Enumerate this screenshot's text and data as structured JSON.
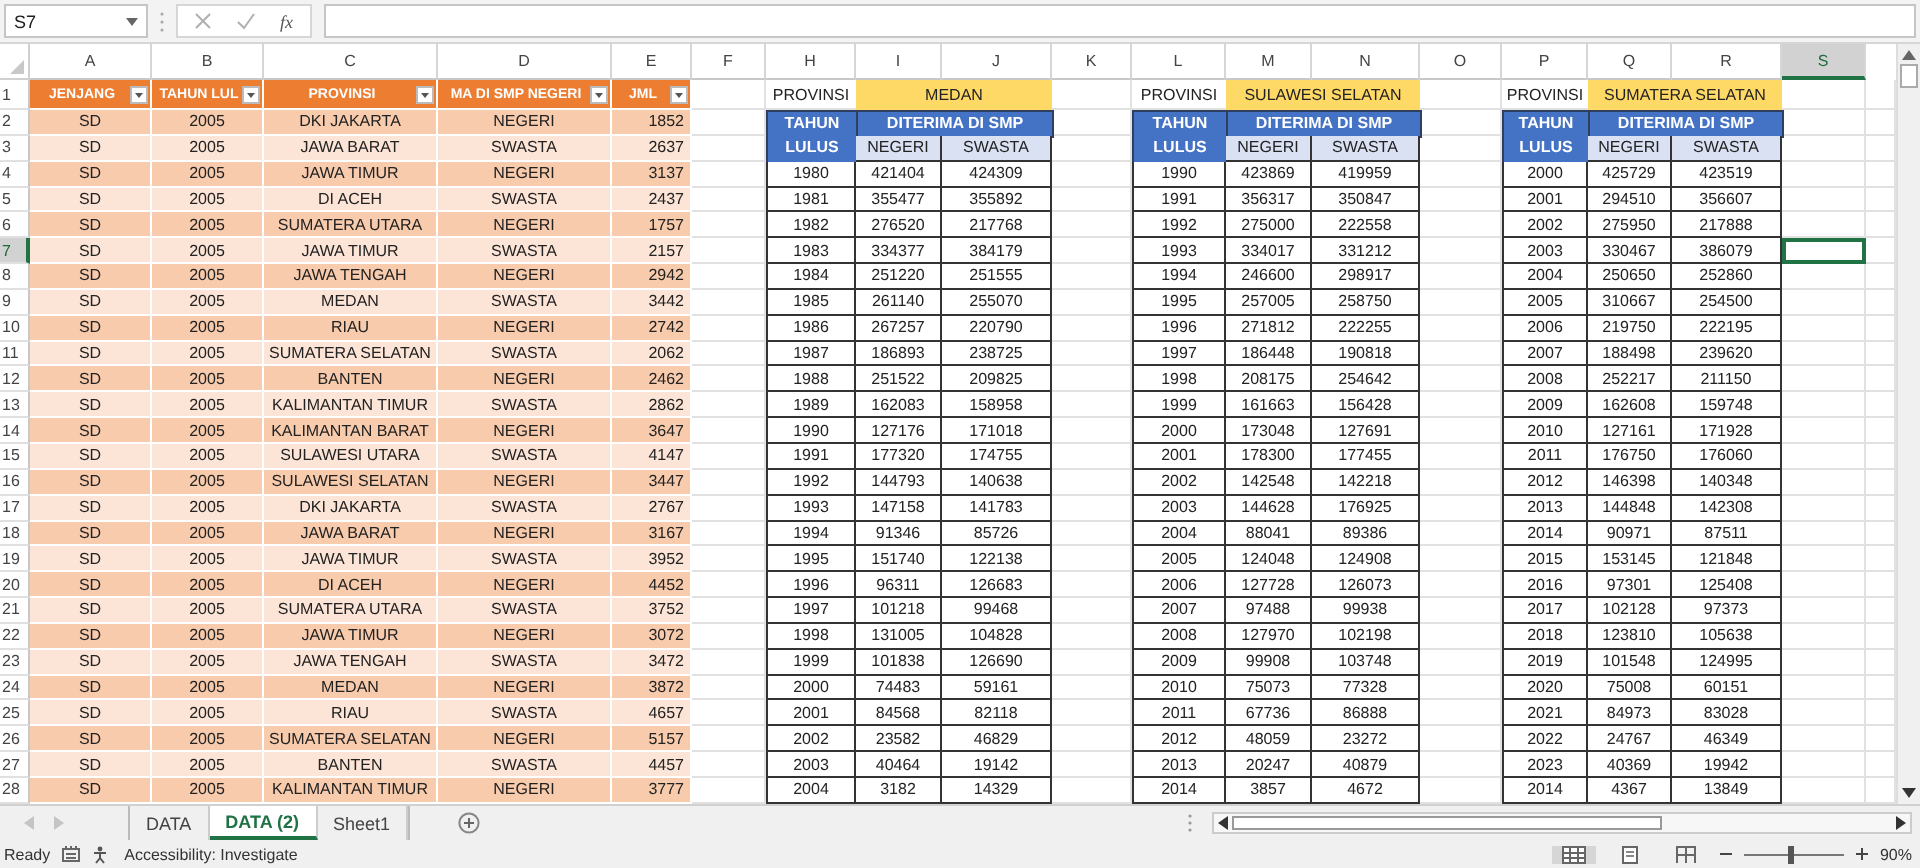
{
  "formula_bar": {
    "name_box": "S7",
    "function_button": "fx"
  },
  "columns": [
    {
      "label": "A",
      "selected": false
    },
    {
      "label": "B",
      "selected": false
    },
    {
      "label": "C",
      "selected": false
    },
    {
      "label": "D",
      "selected": false
    },
    {
      "label": "E",
      "selected": false
    },
    {
      "label": "F",
      "selected": false
    },
    {
      "label": "H",
      "selected": false
    },
    {
      "label": "I",
      "selected": false
    },
    {
      "label": "J",
      "selected": false
    },
    {
      "label": "K",
      "selected": false
    },
    {
      "label": "L",
      "selected": false
    },
    {
      "label": "M",
      "selected": false
    },
    {
      "label": "N",
      "selected": false
    },
    {
      "label": "O",
      "selected": false
    },
    {
      "label": "P",
      "selected": false
    },
    {
      "label": "Q",
      "selected": false
    },
    {
      "label": "R",
      "selected": false
    },
    {
      "label": "S",
      "selected": true
    }
  ],
  "row_numbers": [
    {
      "label": "1",
      "selected": false
    },
    {
      "label": "2",
      "selected": false
    },
    {
      "label": "3",
      "selected": false
    },
    {
      "label": "4",
      "selected": false
    },
    {
      "label": "5",
      "selected": false
    },
    {
      "label": "6",
      "selected": false
    },
    {
      "label": "7",
      "selected": true
    },
    {
      "label": "8",
      "selected": false
    },
    {
      "label": "9",
      "selected": false
    },
    {
      "label": "10",
      "selected": false
    },
    {
      "label": "11",
      "selected": false
    },
    {
      "label": "12",
      "selected": false
    },
    {
      "label": "13",
      "selected": false
    },
    {
      "label": "14",
      "selected": false
    },
    {
      "label": "15",
      "selected": false
    },
    {
      "label": "16",
      "selected": false
    },
    {
      "label": "17",
      "selected": false
    },
    {
      "label": "18",
      "selected": false
    },
    {
      "label": "19",
      "selected": false
    },
    {
      "label": "20",
      "selected": false
    },
    {
      "label": "21",
      "selected": false
    },
    {
      "label": "22",
      "selected": false
    },
    {
      "label": "23",
      "selected": false
    },
    {
      "label": "24",
      "selected": false
    },
    {
      "label": "25",
      "selected": false
    },
    {
      "label": "26",
      "selected": false
    },
    {
      "label": "27",
      "selected": false
    },
    {
      "label": "28",
      "selected": false
    }
  ],
  "data_table": {
    "headers": [
      "JENJANG",
      "TAHUN LUL",
      "PROVINSI",
      "MA DI SMP NEGERI",
      "JML"
    ],
    "rows": [
      [
        "SD",
        "2005",
        "DKI JAKARTA",
        "NEGERI",
        "1852"
      ],
      [
        "SD",
        "2005",
        "JAWA BARAT",
        "SWASTA",
        "2637"
      ],
      [
        "SD",
        "2005",
        "JAWA TIMUR",
        "NEGERI",
        "3137"
      ],
      [
        "SD",
        "2005",
        "DI ACEH",
        "SWASTA",
        "2437"
      ],
      [
        "SD",
        "2005",
        "SUMATERA UTARA",
        "NEGERI",
        "1757"
      ],
      [
        "SD",
        "2005",
        "JAWA TIMUR",
        "SWASTA",
        "2157"
      ],
      [
        "SD",
        "2005",
        "JAWA TENGAH",
        "NEGERI",
        "2942"
      ],
      [
        "SD",
        "2005",
        "MEDAN",
        "SWASTA",
        "3442"
      ],
      [
        "SD",
        "2005",
        "RIAU",
        "NEGERI",
        "2742"
      ],
      [
        "SD",
        "2005",
        "SUMATERA SELATAN",
        "SWASTA",
        "2062"
      ],
      [
        "SD",
        "2005",
        "BANTEN",
        "NEGERI",
        "2462"
      ],
      [
        "SD",
        "2005",
        "KALIMANTAN TIMUR",
        "SWASTA",
        "2862"
      ],
      [
        "SD",
        "2005",
        "KALIMANTAN BARAT",
        "NEGERI",
        "3647"
      ],
      [
        "SD",
        "2005",
        "SULAWESI UTARA",
        "SWASTA",
        "4147"
      ],
      [
        "SD",
        "2005",
        "SULAWESI SELATAN",
        "NEGERI",
        "3447"
      ],
      [
        "SD",
        "2005",
        "DKI JAKARTA",
        "SWASTA",
        "2767"
      ],
      [
        "SD",
        "2005",
        "JAWA BARAT",
        "NEGERI",
        "3167"
      ],
      [
        "SD",
        "2005",
        "JAWA TIMUR",
        "SWASTA",
        "3952"
      ],
      [
        "SD",
        "2005",
        "DI ACEH",
        "NEGERI",
        "4452"
      ],
      [
        "SD",
        "2005",
        "SUMATERA UTARA",
        "SWASTA",
        "3752"
      ],
      [
        "SD",
        "2005",
        "JAWA TIMUR",
        "NEGERI",
        "3072"
      ],
      [
        "SD",
        "2005",
        "JAWA TENGAH",
        "SWASTA",
        "3472"
      ],
      [
        "SD",
        "2005",
        "MEDAN",
        "NEGERI",
        "3872"
      ],
      [
        "SD",
        "2005",
        "RIAU",
        "SWASTA",
        "4657"
      ],
      [
        "SD",
        "2005",
        "SUMATERA SELATAN",
        "NEGERI",
        "5157"
      ],
      [
        "SD",
        "2005",
        "BANTEN",
        "SWASTA",
        "4457"
      ],
      [
        "SD",
        "2005",
        "KALIMANTAN TIMUR",
        "NEGERI",
        "3777"
      ]
    ]
  },
  "summary_tables": [
    {
      "label": "PROVINSI",
      "province": "MEDAN",
      "year_header": "TAHUN LULUS",
      "group_header": "DITERIMA DI SMP",
      "subheaders": [
        "NEGERI",
        "SWASTA"
      ],
      "rows": [
        [
          "1980",
          "421404",
          "424309"
        ],
        [
          "1981",
          "355477",
          "355892"
        ],
        [
          "1982",
          "276520",
          "217768"
        ],
        [
          "1983",
          "334377",
          "384179"
        ],
        [
          "1984",
          "251220",
          "251555"
        ],
        [
          "1985",
          "261140",
          "255070"
        ],
        [
          "1986",
          "267257",
          "220790"
        ],
        [
          "1987",
          "186893",
          "238725"
        ],
        [
          "1988",
          "251522",
          "209825"
        ],
        [
          "1989",
          "162083",
          "158958"
        ],
        [
          "1990",
          "127176",
          "171018"
        ],
        [
          "1991",
          "177320",
          "174755"
        ],
        [
          "1992",
          "144793",
          "140638"
        ],
        [
          "1993",
          "147158",
          "141783"
        ],
        [
          "1994",
          "91346",
          "85726"
        ],
        [
          "1995",
          "151740",
          "122138"
        ],
        [
          "1996",
          "96311",
          "126683"
        ],
        [
          "1997",
          "101218",
          "99468"
        ],
        [
          "1998",
          "131005",
          "104828"
        ],
        [
          "1999",
          "101838",
          "126690"
        ],
        [
          "2000",
          "74483",
          "59161"
        ],
        [
          "2001",
          "84568",
          "82118"
        ],
        [
          "2002",
          "23582",
          "46829"
        ],
        [
          "2003",
          "40464",
          "19142"
        ],
        [
          "2004",
          "3182",
          "14329"
        ]
      ]
    },
    {
      "label": "PROVINSI",
      "province": "SULAWESI SELATAN",
      "year_header": "TAHUN LULUS",
      "group_header": "DITERIMA DI SMP",
      "subheaders": [
        "NEGERI",
        "SWASTA"
      ],
      "rows": [
        [
          "1990",
          "423869",
          "419959"
        ],
        [
          "1991",
          "356317",
          "350847"
        ],
        [
          "1992",
          "275000",
          "222558"
        ],
        [
          "1993",
          "334017",
          "331212"
        ],
        [
          "1994",
          "246600",
          "298917"
        ],
        [
          "1995",
          "257005",
          "258750"
        ],
        [
          "1996",
          "271812",
          "222255"
        ],
        [
          "1997",
          "186448",
          "190818"
        ],
        [
          "1998",
          "208175",
          "254642"
        ],
        [
          "1999",
          "161663",
          "156428"
        ],
        [
          "2000",
          "173048",
          "127691"
        ],
        [
          "2001",
          "178300",
          "177455"
        ],
        [
          "2002",
          "142548",
          "142218"
        ],
        [
          "2003",
          "144628",
          "176925"
        ],
        [
          "2004",
          "88041",
          "89386"
        ],
        [
          "2005",
          "124048",
          "124908"
        ],
        [
          "2006",
          "127728",
          "126073"
        ],
        [
          "2007",
          "97488",
          "99938"
        ],
        [
          "2008",
          "127970",
          "102198"
        ],
        [
          "2009",
          "99908",
          "103748"
        ],
        [
          "2010",
          "75073",
          "77328"
        ],
        [
          "2011",
          "67736",
          "86888"
        ],
        [
          "2012",
          "48059",
          "23272"
        ],
        [
          "2013",
          "20247",
          "40879"
        ],
        [
          "2014",
          "3857",
          "4672"
        ]
      ]
    },
    {
      "label": "PROVINSI",
      "province": "SUMATERA SELATAN",
      "year_header": "TAHUN LULUS",
      "group_header": "DITERIMA DI SMP",
      "subheaders": [
        "NEGERI",
        "SWASTA"
      ],
      "rows": [
        [
          "2000",
          "425729",
          "423519"
        ],
        [
          "2001",
          "294510",
          "356607"
        ],
        [
          "2002",
          "275950",
          "217888"
        ],
        [
          "2003",
          "330467",
          "386079"
        ],
        [
          "2004",
          "250650",
          "252860"
        ],
        [
          "2005",
          "310667",
          "254500"
        ],
        [
          "2006",
          "219750",
          "222195"
        ],
        [
          "2007",
          "188498",
          "239620"
        ],
        [
          "2008",
          "252217",
          "211150"
        ],
        [
          "2009",
          "162608",
          "159748"
        ],
        [
          "2010",
          "127161",
          "171928"
        ],
        [
          "2011",
          "176750",
          "176060"
        ],
        [
          "2012",
          "146398",
          "140348"
        ],
        [
          "2013",
          "144848",
          "142308"
        ],
        [
          "2014",
          "90971",
          "87511"
        ],
        [
          "2015",
          "153145",
          "121848"
        ],
        [
          "2016",
          "97301",
          "125408"
        ],
        [
          "2017",
          "102128",
          "97373"
        ],
        [
          "2018",
          "123810",
          "105638"
        ],
        [
          "2019",
          "101548",
          "124995"
        ],
        [
          "2020",
          "75008",
          "60151"
        ],
        [
          "2021",
          "84973",
          "83028"
        ],
        [
          "2022",
          "24767",
          "46349"
        ],
        [
          "2023",
          "40369",
          "19942"
        ],
        [
          "2014",
          "4367",
          "13849"
        ]
      ]
    }
  ],
  "sheet_tabs": [
    {
      "label": "DATA",
      "selected": false
    },
    {
      "label": "DATA (2)",
      "selected": true
    },
    {
      "label": "Sheet1",
      "selected": false
    }
  ],
  "status_bar": {
    "mode": "Ready",
    "accessibility": "Accessibility: Investigate",
    "zoom_slider": {
      "level": 0.46
    },
    "zoom": "90%"
  }
}
